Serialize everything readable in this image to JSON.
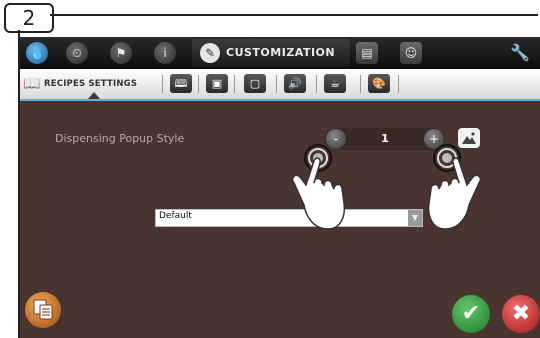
{
  "step": "2",
  "topbar": {
    "active_tab_label": "CUSTOMIZATION",
    "icons": [
      "water-drop-icon",
      "clock-icon",
      "flag-icon",
      "info-icon",
      "pencil-icon",
      "display-icon",
      "user-icon",
      "wrench-icon"
    ]
  },
  "subbar": {
    "active_label": "RECIPES SETTINGS",
    "icons": [
      "book-icon",
      "image-icon",
      "photo-icon",
      "speaker-icon",
      "cup-icon",
      "palette-icon"
    ]
  },
  "setting": {
    "label": "Dispensing Popup Style",
    "value": "1",
    "minus": "-",
    "plus": "+"
  },
  "dropdown": {
    "value": "Default"
  },
  "colors": {
    "screen_bg": "#4a3430",
    "accent_line": "#5fb3d6",
    "ok": "#2a9a37",
    "cancel": "#c62b2b"
  }
}
